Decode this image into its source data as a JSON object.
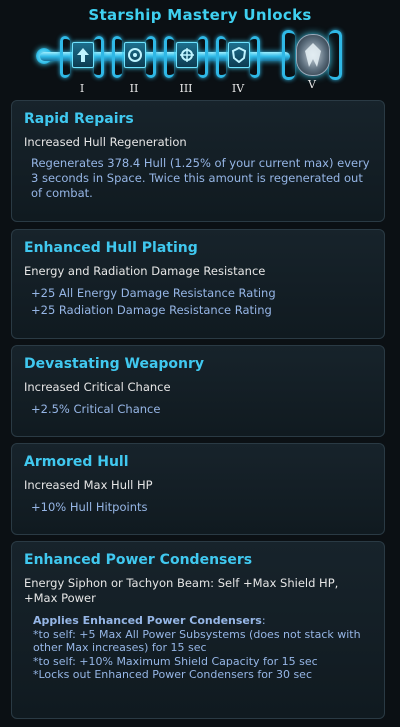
{
  "header": {
    "title": "Starship Mastery Unlocks"
  },
  "track": {
    "numerals": [
      "I",
      "II",
      "III",
      "IV",
      "V"
    ]
  },
  "cards": [
    {
      "title": "Rapid Repairs",
      "subtitle": "Increased Hull Regeneration",
      "details": [
        "Regenerates 378.4 Hull (1.25% of your current max) every 3 seconds in Space. Twice this amount is regenerated out of combat."
      ]
    },
    {
      "title": "Enhanced Hull Plating",
      "subtitle": "Energy and Radiation Damage Resistance",
      "details": [
        "+25 All Energy Damage Resistance Rating",
        "+25 Radiation Damage Resistance Rating"
      ]
    },
    {
      "title": "Devastating Weaponry",
      "subtitle": "Increased Critical Chance",
      "details": [
        "+2.5% Critical Chance"
      ]
    },
    {
      "title": "Armored Hull",
      "subtitle": "Increased Max Hull HP",
      "details": [
        "+10% Hull Hitpoints"
      ]
    },
    {
      "title": "Enhanced Power Condensers",
      "subtitle": "Energy Siphon or Tachyon Beam: Self +Max Shield HP, +Max Power",
      "applies_heading": "Applies Enhanced Power Condensers",
      "applies_lines": [
        "*to self: +5 Max All Power Subsystems (does not stack with other Max increases) for 15 sec",
        "*to self: +10% Maximum Shield Capacity for 15 sec",
        "*Locks out Enhanced Power Condensers for 30 sec"
      ]
    }
  ]
}
